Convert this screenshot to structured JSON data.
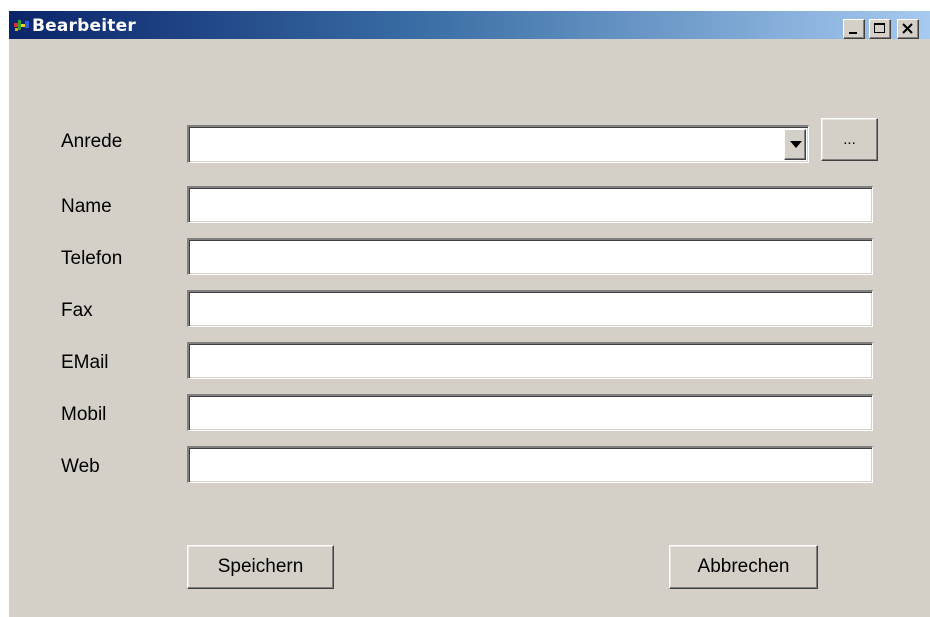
{
  "window": {
    "title": "Bearbeiter",
    "controls": {
      "minimize": "minimize-icon",
      "maximize": "maximize-icon",
      "close": "close-icon"
    }
  },
  "form": {
    "anrede": {
      "label": "Anrede",
      "value": "",
      "browse_label": "..."
    },
    "fields": [
      {
        "key": "name",
        "label": "Name",
        "value": ""
      },
      {
        "key": "telefon",
        "label": "Telefon",
        "value": ""
      },
      {
        "key": "fax",
        "label": "Fax",
        "value": ""
      },
      {
        "key": "email",
        "label": "EMail",
        "value": ""
      },
      {
        "key": "mobil",
        "label": "Mobil",
        "value": ""
      },
      {
        "key": "web",
        "label": "Web",
        "value": ""
      }
    ]
  },
  "buttons": {
    "save": "Speichern",
    "cancel": "Abbrechen"
  },
  "colors": {
    "titlebar_start": "#0a246a",
    "titlebar_end": "#a6caf0",
    "face": "#d4d0c8"
  }
}
